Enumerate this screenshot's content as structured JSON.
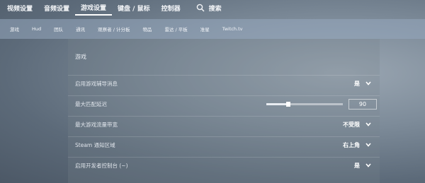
{
  "topnav": {
    "tabs": [
      "视频设置",
      "音频设置",
      "游戏设置",
      "键盘 / 鼠标",
      "控制器"
    ],
    "active_index": 2,
    "search_label": "搜索"
  },
  "subnav": {
    "items": [
      "游戏",
      "Hud",
      "团队",
      "通讯",
      "观察者 / 计分板",
      "物品",
      "雷达 / 平板",
      "准星",
      "Twitch.tv"
    ]
  },
  "section": {
    "title": "游戏",
    "rows": [
      {
        "label": "启用游戏辅导消息",
        "value": "是"
      },
      {
        "label": "最大匹配延迟",
        "value": "90",
        "slider_fraction": 0.29
      },
      {
        "label": "最大游戏流量带宽",
        "value": "不受限"
      },
      {
        "label": "Steam 通知区域",
        "value": "右上角"
      },
      {
        "label": "启用开发者控制台 (~)",
        "value": "是"
      }
    ]
  },
  "colors": {
    "text": "#ffffff",
    "subnav_bg": "#96a8be"
  }
}
